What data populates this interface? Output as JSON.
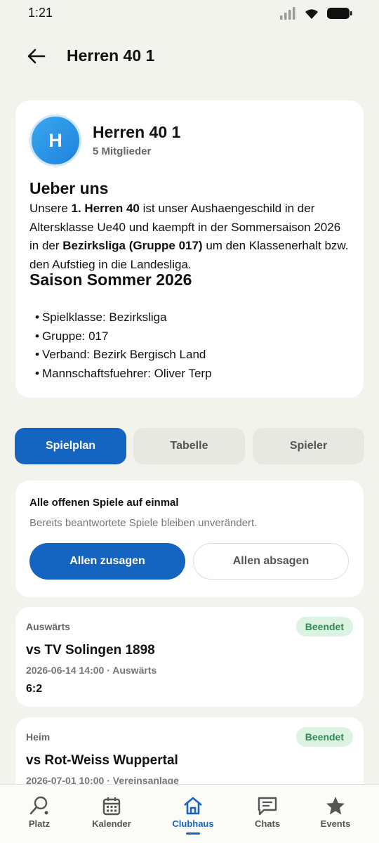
{
  "status": {
    "time": "1:21"
  },
  "header": {
    "title": "Herren 40 1"
  },
  "club": {
    "avatar_letter": "H",
    "name": "Herren 40 1",
    "members": "5 Mitglieder",
    "about_title": "Ueber uns",
    "about_parts": [
      "Unsere ",
      "1. Herren 40",
      " ist unser Aushaengeschild in der Altersklasse Ue40 und kaempft in der Sommersaison 2026 in der ",
      "Bezirksliga (Gruppe 017)",
      " um den Klassenerhalt bzw. den Aufstieg in die Landesliga."
    ],
    "season_title": "Saison Sommer 2026",
    "season_items": [
      "Spielklasse: Bezirksliga",
      "Gruppe: 017",
      "Verband: Bezirk Bergisch Land",
      "Mannschaftsfuehrer: Oliver Terp"
    ]
  },
  "tabs": [
    {
      "label": "Spielplan",
      "active": true
    },
    {
      "label": "Tabelle",
      "active": false
    },
    {
      "label": "Spieler",
      "active": false
    }
  ],
  "bulk": {
    "title": "Alle offenen Spiele auf einmal",
    "subtitle": "Bereits beantwortete Spiele bleiben unverändert.",
    "accept_label": "Allen zusagen",
    "decline_label": "Allen absagen"
  },
  "matches": [
    {
      "type": "Auswärts",
      "status": "Beendet",
      "opponent": "vs TV Solingen 1898",
      "meta": "2026-06-14 14:00 · Auswärts",
      "score": "6:2"
    },
    {
      "type": "Heim",
      "status": "Beendet",
      "opponent": "vs Rot-Weiss Wuppertal",
      "meta": "2026-07-01 10:00 · Vereinsanlage",
      "score": ""
    }
  ],
  "nav": [
    {
      "label": "Platz",
      "icon": "court-icon",
      "active": false
    },
    {
      "label": "Kalender",
      "icon": "calendar-icon",
      "active": false
    },
    {
      "label": "Clubhaus",
      "icon": "home-icon",
      "active": true
    },
    {
      "label": "Chats",
      "icon": "chat-icon",
      "active": false
    },
    {
      "label": "Events",
      "icon": "star-icon",
      "active": false
    }
  ],
  "colors": {
    "primary": "#1565c0",
    "background": "#f3f3ee",
    "badge_bg": "#dcf3e4",
    "badge_text": "#2e8b50"
  }
}
